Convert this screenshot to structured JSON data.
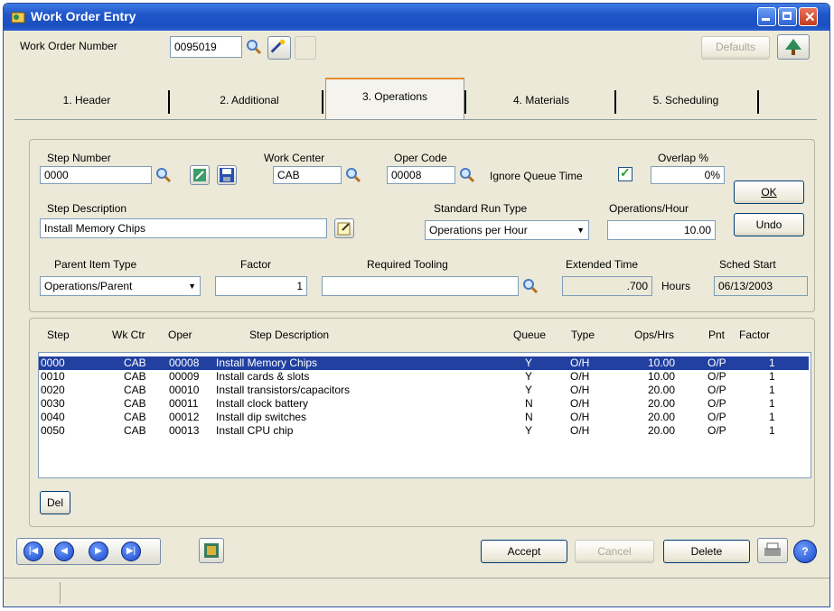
{
  "window": {
    "title": "Work Order Entry"
  },
  "header": {
    "wo_label": "Work Order Number",
    "wo_value": "0095019",
    "defaults_label": "Defaults"
  },
  "tabs": [
    {
      "label": "1. Header"
    },
    {
      "label": "2. Additional"
    },
    {
      "label": "3. Operations"
    },
    {
      "label": "4. Materials"
    },
    {
      "label": "5. Scheduling"
    }
  ],
  "ops": {
    "step_number_label": "Step Number",
    "step_number": "0000",
    "work_center_label": "Work Center",
    "work_center": "CAB",
    "oper_code_label": "Oper Code",
    "oper_code": "00008",
    "ignore_queue_label": "Ignore Queue Time",
    "ignore_queue_checked": true,
    "overlap_label": "Overlap %",
    "overlap": "0%",
    "step_desc_label": "Step Description",
    "step_desc": "Install Memory Chips",
    "std_run_type_label": "Standard Run Type",
    "std_run_type": "Operations per Hour",
    "ops_hour_label": "Operations/Hour",
    "ops_hour": "10.00",
    "parent_item_type_label": "Parent Item Type",
    "parent_item_type": "Operations/Parent",
    "factor_label": "Factor",
    "factor": "1",
    "required_tooling_label": "Required Tooling",
    "required_tooling": "",
    "extended_time_label": "Extended Time",
    "extended_time": ".700",
    "hours_label": "Hours",
    "sched_start_label": "Sched Start",
    "sched_start": "06/13/2003",
    "ok_label": "OK",
    "undo_label": "Undo"
  },
  "grid": {
    "columns": [
      "Step",
      "Wk Ctr",
      "Oper",
      "Step Description",
      "Queue",
      "Type",
      "Ops/Hrs",
      "Pnt",
      "Factor"
    ],
    "rows": [
      {
        "step": "0000",
        "wkctr": "CAB",
        "oper": "00008",
        "desc": "Install Memory Chips",
        "queue": "Y",
        "type": "O/H",
        "ops": "10.00",
        "pnt": "O/P",
        "factor": "1"
      },
      {
        "step": "0010",
        "wkctr": "CAB",
        "oper": "00009",
        "desc": "Install cards & slots",
        "queue": "Y",
        "type": "O/H",
        "ops": "10.00",
        "pnt": "O/P",
        "factor": "1"
      },
      {
        "step": "0020",
        "wkctr": "CAB",
        "oper": "00010",
        "desc": "Install transistors/capacitors",
        "queue": "Y",
        "type": "O/H",
        "ops": "20.00",
        "pnt": "O/P",
        "factor": "1"
      },
      {
        "step": "0030",
        "wkctr": "CAB",
        "oper": "00011",
        "desc": "Install clock battery",
        "queue": "N",
        "type": "O/H",
        "ops": "20.00",
        "pnt": "O/P",
        "factor": "1"
      },
      {
        "step": "0040",
        "wkctr": "CAB",
        "oper": "00012",
        "desc": "Install dip switches",
        "queue": "N",
        "type": "O/H",
        "ops": "20.00",
        "pnt": "O/P",
        "factor": "1"
      },
      {
        "step": "0050",
        "wkctr": "CAB",
        "oper": "00013",
        "desc": "Install CPU chip",
        "queue": "Y",
        "type": "O/H",
        "ops": "20.00",
        "pnt": "O/P",
        "factor": "1"
      }
    ],
    "del_label": "Del"
  },
  "footer": {
    "accept_label": "Accept",
    "cancel_label": "Cancel",
    "delete_label": "Delete"
  },
  "icons": {
    "app": "app-icon",
    "lookup": "magnifier-icon",
    "nav": [
      "first-record-icon",
      "previous-record-icon",
      "next-record-icon",
      "last-record-icon"
    ],
    "help": "help-icon",
    "print": "printer-icon"
  },
  "colors": {
    "titlebar": "#1f56c9",
    "selection": "#2140a0",
    "tab_highlight": "#e68b2c"
  }
}
